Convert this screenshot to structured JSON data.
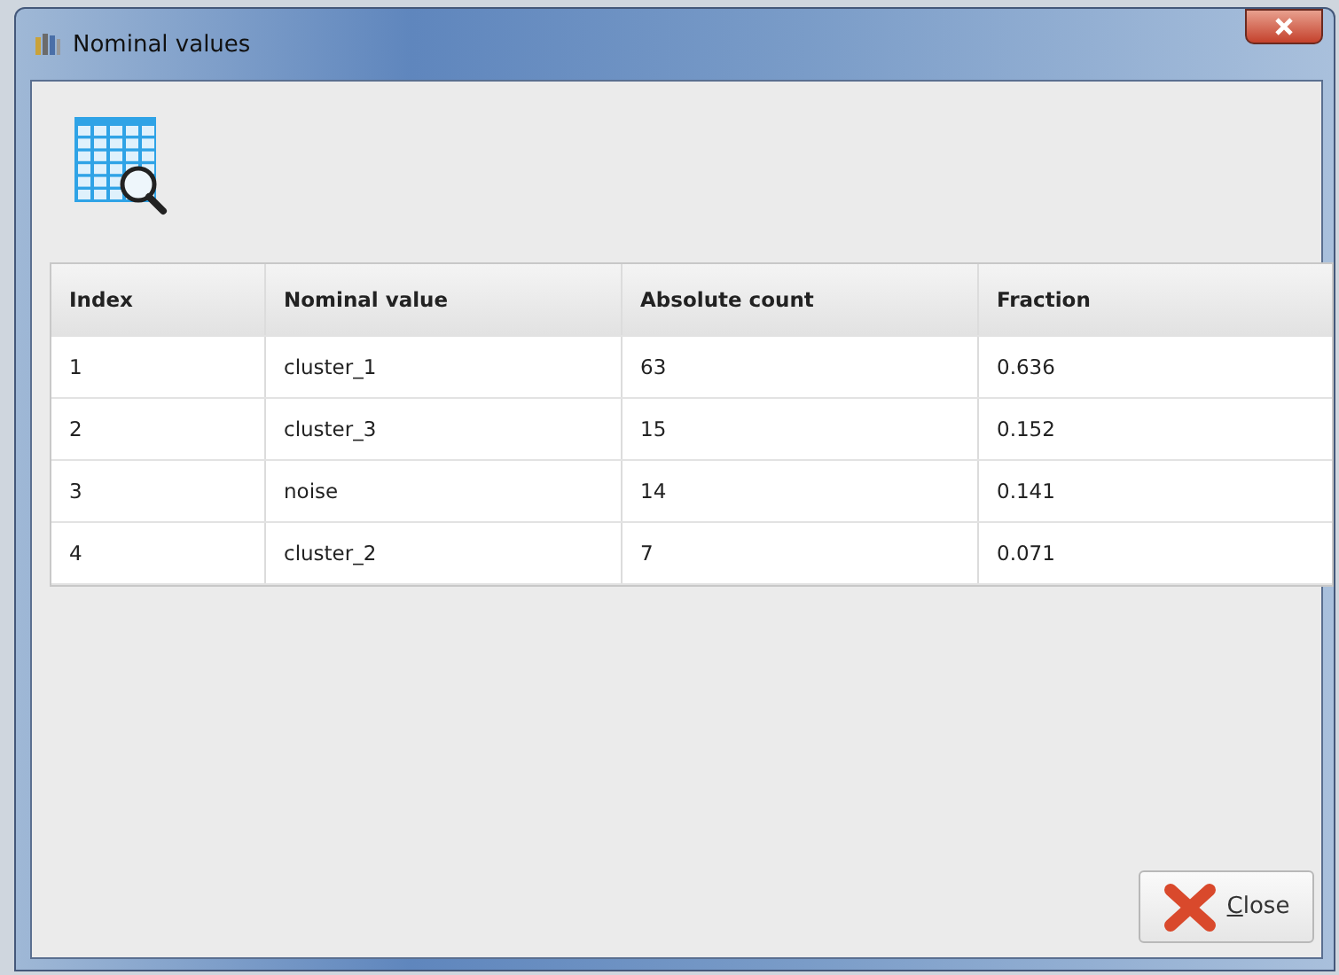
{
  "window": {
    "title": "Nominal values"
  },
  "table": {
    "columns": [
      "Index",
      "Nominal value",
      "Absolute count",
      "Fraction"
    ],
    "rows": [
      [
        "1",
        "cluster_1",
        "63",
        "0.636"
      ],
      [
        "2",
        "cluster_3",
        "15",
        "0.152"
      ],
      [
        "3",
        "noise",
        "14",
        "0.141"
      ],
      [
        "4",
        "cluster_2",
        "7",
        "0.071"
      ]
    ]
  },
  "buttons": [
    {
      "label": "Close"
    }
  ]
}
